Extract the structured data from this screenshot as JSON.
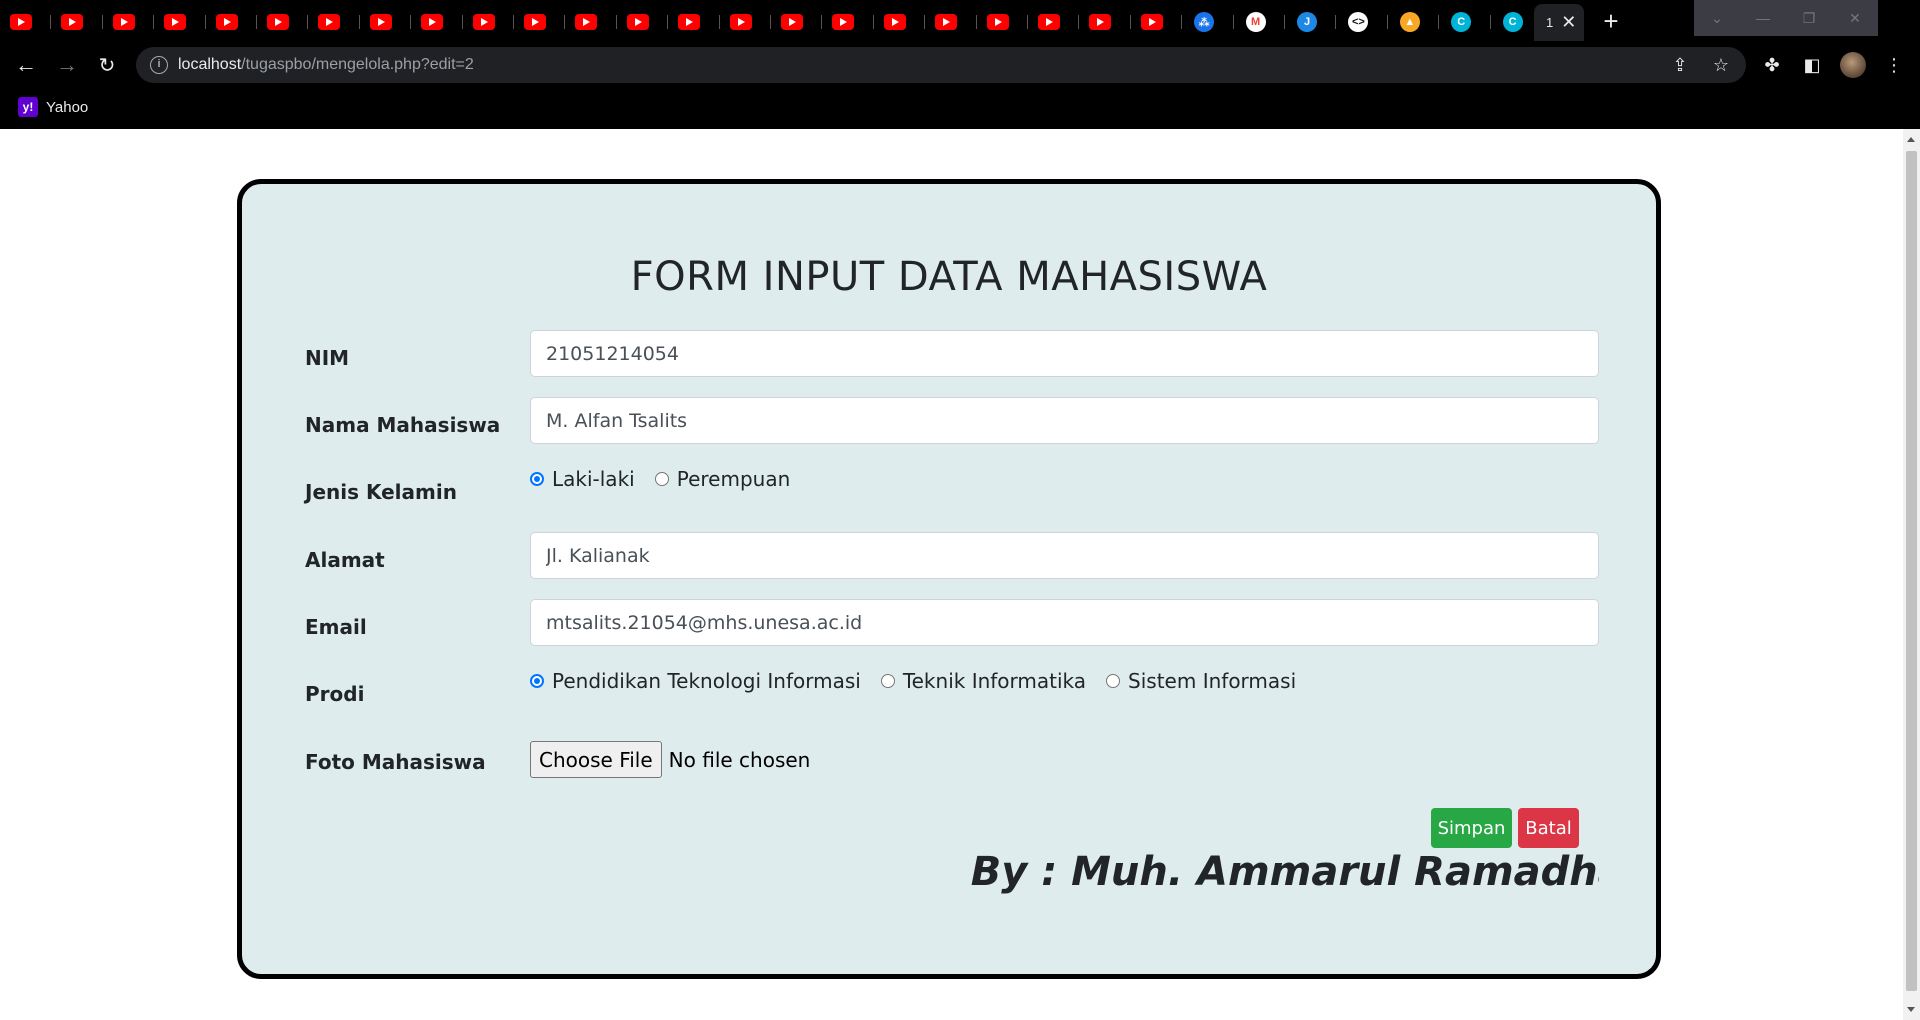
{
  "browser": {
    "active_tab_title": "1",
    "url_host": "localhost",
    "url_path": "/tugaspbo/mengelola.php?edit=2",
    "bookmark_label": "Yahoo"
  },
  "form": {
    "title": "FORM INPUT DATA MAHASISWA",
    "nim_label": "NIM",
    "nim_value": "21051214054",
    "nama_label": "Nama Mahasiswa",
    "nama_value": "M. Alfan Tsalits",
    "jk_label": "Jenis Kelamin",
    "jk_options": [
      "Laki-laki",
      "Perempuan"
    ],
    "jk_selected": "Laki-laki",
    "alamat_label": "Alamat",
    "alamat_value": "Jl. Kalianak",
    "email_label": "Email",
    "email_value": "mtsalits.21054@mhs.unesa.ac.id",
    "prodi_label": "Prodi",
    "prodi_options": [
      "Pendidikan Teknologi Informasi",
      "Teknik Informatika",
      "Sistem Informasi"
    ],
    "prodi_selected": "Pendidikan Teknologi Informasi",
    "foto_label": "Foto Mahasiswa",
    "file_button": "Choose File",
    "file_status": "No file chosen",
    "save_label": "Simpan",
    "cancel_label": "Batal",
    "byline": "By : Muh. Ammarul Ramadhan Ja"
  },
  "colors": {
    "card_bg": "#dfeced",
    "save": "#28a745",
    "cancel": "#dc3545",
    "radio_accent": "#0075ff"
  }
}
